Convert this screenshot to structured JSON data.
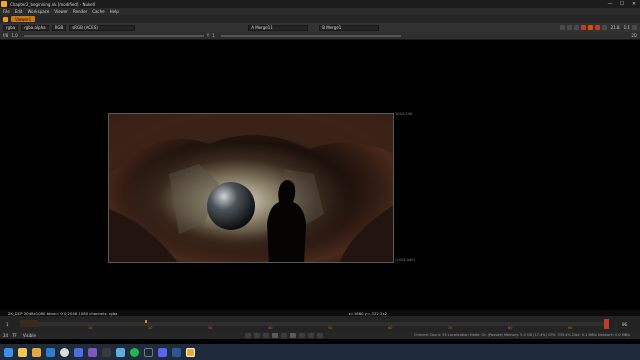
{
  "window": {
    "title": "Chapter2_beginning.nk [modified] - NukeX",
    "minimize": "—",
    "maximize": "☐",
    "close": "✕"
  },
  "menu": [
    "File",
    "Edit",
    "Workspace",
    "Viewer",
    "Render",
    "Cache",
    "Help"
  ],
  "tabs": [
    {
      "label": "Viewer1"
    }
  ],
  "toolbar1": {
    "channels": "rgba",
    "layer": "rgba.alpha",
    "colorspace": "RGB",
    "display": "sRGB (ACES)",
    "input_a": "A  Merge11",
    "input_b": "B  Merge1",
    "zoom": "21.8",
    "ratio": "1:1"
  },
  "toolbar2": {
    "gain_label": "f/8",
    "gain_value": "1.0",
    "gamma_label": "Y",
    "gamma_value": "1",
    "right_label": "2D"
  },
  "viewer": {
    "format_label": "1024,540",
    "coord_label": "(1024,540)"
  },
  "infobar": {
    "left": "2K_DCP 2048x1080  bbox= 0 0 2048 1080 channels: rgba",
    "right": "x=1660 y=-322.2x2"
  },
  "timeline": {
    "start": "1",
    "end": "96",
    "ticks": [
      "10",
      "20",
      "30",
      "40",
      "50",
      "60",
      "70",
      "80",
      "90"
    ]
  },
  "controls": {
    "fps": "24",
    "mode": "TF",
    "playback_mode": "Visible",
    "status": "Channel Count: 55  Localization Mode: On (Paused)  Memory: 5.0 GB (17.4%)  CPU: 333.4%  Disk: 0.1 MB/s  Network: 0.0 MB/s"
  },
  "colors": {
    "accent": "#c97a10",
    "background": "#000000",
    "panel": "#2b2b2b"
  },
  "taskbar": {
    "icons": [
      "windows-start",
      "file-explorer",
      "folder",
      "mail",
      "chrome",
      "store",
      "vscode",
      "terminal",
      "photos",
      "spotify",
      "steam",
      "discord",
      "word",
      "nuke"
    ]
  }
}
